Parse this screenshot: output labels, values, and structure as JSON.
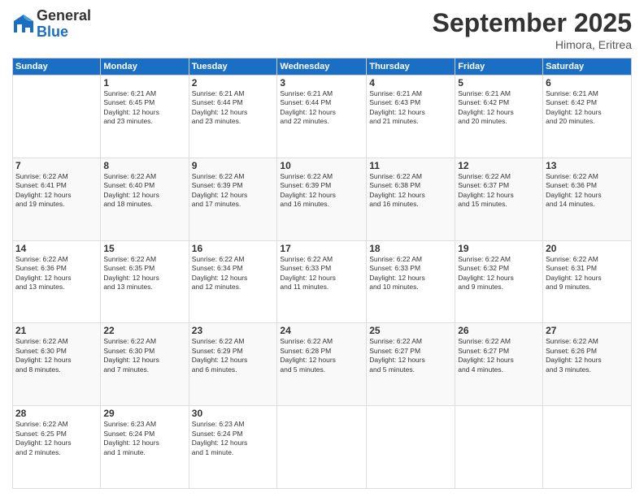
{
  "logo": {
    "general": "General",
    "blue": "Blue"
  },
  "header": {
    "month": "September 2025",
    "location": "Himora, Eritrea"
  },
  "weekdays": [
    "Sunday",
    "Monday",
    "Tuesday",
    "Wednesday",
    "Thursday",
    "Friday",
    "Saturday"
  ],
  "weeks": [
    [
      {
        "day": "",
        "info": ""
      },
      {
        "day": "1",
        "info": "Sunrise: 6:21 AM\nSunset: 6:45 PM\nDaylight: 12 hours\nand 23 minutes."
      },
      {
        "day": "2",
        "info": "Sunrise: 6:21 AM\nSunset: 6:44 PM\nDaylight: 12 hours\nand 23 minutes."
      },
      {
        "day": "3",
        "info": "Sunrise: 6:21 AM\nSunset: 6:44 PM\nDaylight: 12 hours\nand 22 minutes."
      },
      {
        "day": "4",
        "info": "Sunrise: 6:21 AM\nSunset: 6:43 PM\nDaylight: 12 hours\nand 21 minutes."
      },
      {
        "day": "5",
        "info": "Sunrise: 6:21 AM\nSunset: 6:42 PM\nDaylight: 12 hours\nand 20 minutes."
      },
      {
        "day": "6",
        "info": "Sunrise: 6:21 AM\nSunset: 6:42 PM\nDaylight: 12 hours\nand 20 minutes."
      }
    ],
    [
      {
        "day": "7",
        "info": "Sunrise: 6:22 AM\nSunset: 6:41 PM\nDaylight: 12 hours\nand 19 minutes."
      },
      {
        "day": "8",
        "info": "Sunrise: 6:22 AM\nSunset: 6:40 PM\nDaylight: 12 hours\nand 18 minutes."
      },
      {
        "day": "9",
        "info": "Sunrise: 6:22 AM\nSunset: 6:39 PM\nDaylight: 12 hours\nand 17 minutes."
      },
      {
        "day": "10",
        "info": "Sunrise: 6:22 AM\nSunset: 6:39 PM\nDaylight: 12 hours\nand 16 minutes."
      },
      {
        "day": "11",
        "info": "Sunrise: 6:22 AM\nSunset: 6:38 PM\nDaylight: 12 hours\nand 16 minutes."
      },
      {
        "day": "12",
        "info": "Sunrise: 6:22 AM\nSunset: 6:37 PM\nDaylight: 12 hours\nand 15 minutes."
      },
      {
        "day": "13",
        "info": "Sunrise: 6:22 AM\nSunset: 6:36 PM\nDaylight: 12 hours\nand 14 minutes."
      }
    ],
    [
      {
        "day": "14",
        "info": "Sunrise: 6:22 AM\nSunset: 6:36 PM\nDaylight: 12 hours\nand 13 minutes."
      },
      {
        "day": "15",
        "info": "Sunrise: 6:22 AM\nSunset: 6:35 PM\nDaylight: 12 hours\nand 13 minutes."
      },
      {
        "day": "16",
        "info": "Sunrise: 6:22 AM\nSunset: 6:34 PM\nDaylight: 12 hours\nand 12 minutes."
      },
      {
        "day": "17",
        "info": "Sunrise: 6:22 AM\nSunset: 6:33 PM\nDaylight: 12 hours\nand 11 minutes."
      },
      {
        "day": "18",
        "info": "Sunrise: 6:22 AM\nSunset: 6:33 PM\nDaylight: 12 hours\nand 10 minutes."
      },
      {
        "day": "19",
        "info": "Sunrise: 6:22 AM\nSunset: 6:32 PM\nDaylight: 12 hours\nand 9 minutes."
      },
      {
        "day": "20",
        "info": "Sunrise: 6:22 AM\nSunset: 6:31 PM\nDaylight: 12 hours\nand 9 minutes."
      }
    ],
    [
      {
        "day": "21",
        "info": "Sunrise: 6:22 AM\nSunset: 6:30 PM\nDaylight: 12 hours\nand 8 minutes."
      },
      {
        "day": "22",
        "info": "Sunrise: 6:22 AM\nSunset: 6:30 PM\nDaylight: 12 hours\nand 7 minutes."
      },
      {
        "day": "23",
        "info": "Sunrise: 6:22 AM\nSunset: 6:29 PM\nDaylight: 12 hours\nand 6 minutes."
      },
      {
        "day": "24",
        "info": "Sunrise: 6:22 AM\nSunset: 6:28 PM\nDaylight: 12 hours\nand 5 minutes."
      },
      {
        "day": "25",
        "info": "Sunrise: 6:22 AM\nSunset: 6:27 PM\nDaylight: 12 hours\nand 5 minutes."
      },
      {
        "day": "26",
        "info": "Sunrise: 6:22 AM\nSunset: 6:27 PM\nDaylight: 12 hours\nand 4 minutes."
      },
      {
        "day": "27",
        "info": "Sunrise: 6:22 AM\nSunset: 6:26 PM\nDaylight: 12 hours\nand 3 minutes."
      }
    ],
    [
      {
        "day": "28",
        "info": "Sunrise: 6:22 AM\nSunset: 6:25 PM\nDaylight: 12 hours\nand 2 minutes."
      },
      {
        "day": "29",
        "info": "Sunrise: 6:23 AM\nSunset: 6:24 PM\nDaylight: 12 hours\nand 1 minute."
      },
      {
        "day": "30",
        "info": "Sunrise: 6:23 AM\nSunset: 6:24 PM\nDaylight: 12 hours\nand 1 minute."
      },
      {
        "day": "",
        "info": ""
      },
      {
        "day": "",
        "info": ""
      },
      {
        "day": "",
        "info": ""
      },
      {
        "day": "",
        "info": ""
      }
    ]
  ]
}
